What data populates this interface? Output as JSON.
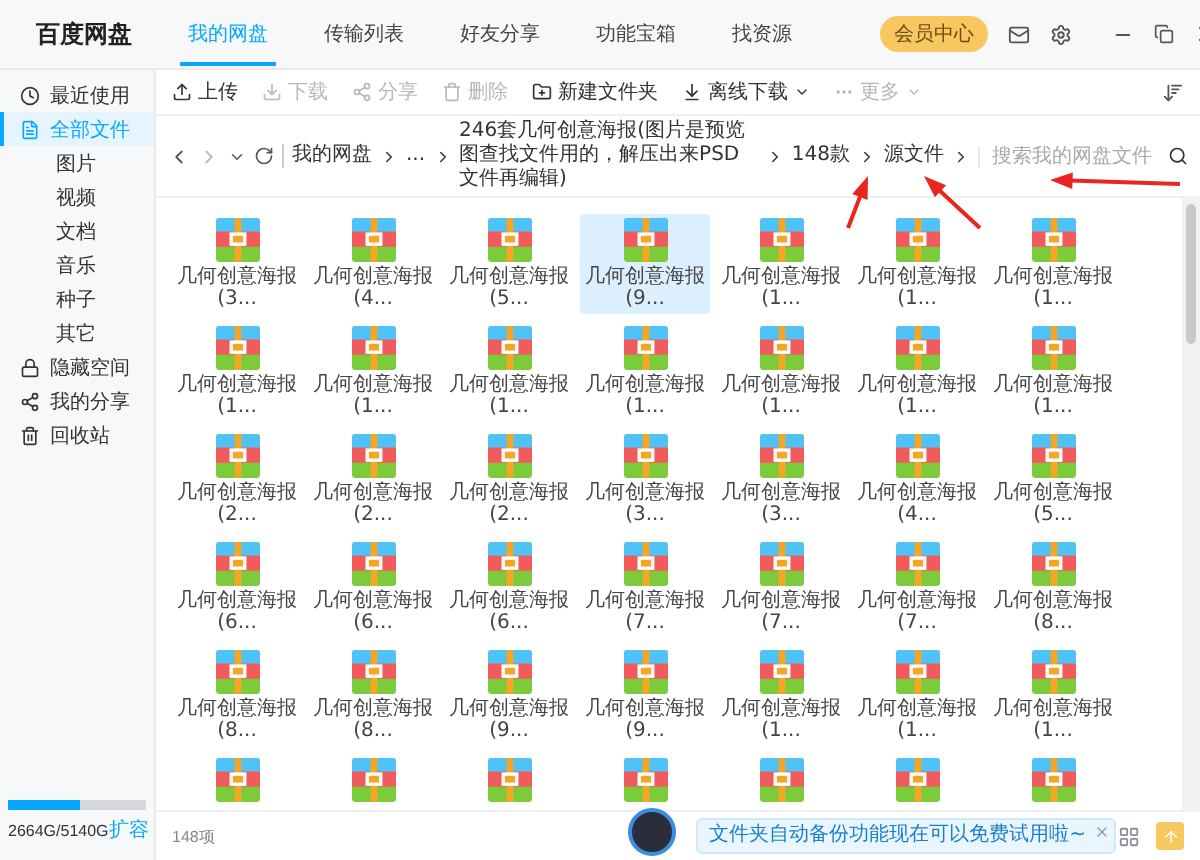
{
  "app": {
    "name": "百度网盘"
  },
  "nav_tabs": [
    {
      "label": "我的网盘",
      "selected": true
    },
    {
      "label": "传输列表",
      "selected": false
    },
    {
      "label": "好友分享",
      "selected": false
    },
    {
      "label": "功能宝箱",
      "selected": false
    },
    {
      "label": "找资源",
      "selected": false
    }
  ],
  "header": {
    "member_button": "会员中心"
  },
  "sidebar": {
    "items": [
      {
        "kind": "recent",
        "label": "最近使用",
        "selected": false
      },
      {
        "kind": "all",
        "label": "全部文件",
        "selected": true,
        "children": [
          {
            "label": "图片",
            "selected": false
          },
          {
            "label": "视频",
            "selected": false
          },
          {
            "label": "文档",
            "selected": false
          },
          {
            "label": "音乐",
            "selected": false
          },
          {
            "label": "种子",
            "selected": false
          },
          {
            "label": "其它",
            "selected": false
          }
        ]
      },
      {
        "kind": "hidden",
        "label": "隐藏空间",
        "selected": false
      },
      {
        "kind": "shares",
        "label": "我的分享",
        "selected": false
      },
      {
        "kind": "trash",
        "label": "回收站",
        "selected": false
      }
    ],
    "storage": {
      "text": "2664G/5140G",
      "level": 0.518,
      "expand_link": "扩容"
    }
  },
  "toolbar": {
    "actions": [
      {
        "kind": "upload",
        "label": "上传",
        "disabled": false
      },
      {
        "kind": "download",
        "label": "下载",
        "disabled": true
      },
      {
        "kind": "share",
        "label": "分享",
        "disabled": true
      },
      {
        "kind": "delete",
        "label": "删除",
        "disabled": true
      },
      {
        "kind": "new-folder",
        "label": "新建文件夹",
        "disabled": false
      },
      {
        "kind": "offline",
        "label": "离线下载",
        "disabled": false,
        "dropdown": true
      },
      {
        "kind": "more",
        "label": "更多",
        "disabled": true,
        "dropdown": true
      }
    ]
  },
  "breadcrumb": {
    "segments": [
      "我的网盘",
      "...",
      "246套几何创意海报(图片是预览图查找文件用的，解压出来PSD文件再编辑)",
      "148款",
      "源文件"
    ],
    "search_placeholder": "搜索我的网盘文件"
  },
  "files": [
    {
      "name": "几何创意海报 (3...",
      "selected": false
    },
    {
      "name": "几何创意海报 (4...",
      "selected": false
    },
    {
      "name": "几何创意海报 (5...",
      "selected": false
    },
    {
      "name": "几何创意海报 (9...",
      "selected": true
    },
    {
      "name": "几何创意海报 (1...",
      "selected": false
    },
    {
      "name": "几何创意海报 (1...",
      "selected": false
    },
    {
      "name": "几何创意海报 (1...",
      "selected": false
    },
    {
      "name": "几何创意海报 (1...",
      "selected": false
    },
    {
      "name": "几何创意海报 (1...",
      "selected": false
    },
    {
      "name": "几何创意海报 (1...",
      "selected": false
    },
    {
      "name": "几何创意海报 (1...",
      "selected": false
    },
    {
      "name": "几何创意海报 (1...",
      "selected": false
    },
    {
      "name": "几何创意海报 (1...",
      "selected": false
    },
    {
      "name": "几何创意海报 (1...",
      "selected": false
    },
    {
      "name": "几何创意海报 (2...",
      "selected": false
    },
    {
      "name": "几何创意海报 (2...",
      "selected": false
    },
    {
      "name": "几何创意海报 (2...",
      "selected": false
    },
    {
      "name": "几何创意海报 (3...",
      "selected": false
    },
    {
      "name": "几何创意海报 (3...",
      "selected": false
    },
    {
      "name": "几何创意海报 (4...",
      "selected": false
    },
    {
      "name": "几何创意海报 (5...",
      "selected": false
    },
    {
      "name": "几何创意海报 (6...",
      "selected": false
    },
    {
      "name": "几何创意海报 (6...",
      "selected": false
    },
    {
      "name": "几何创意海报 (6...",
      "selected": false
    },
    {
      "name": "几何创意海报 (7...",
      "selected": false
    },
    {
      "name": "几何创意海报 (7...",
      "selected": false
    },
    {
      "name": "几何创意海报 (7...",
      "selected": false
    },
    {
      "name": "几何创意海报 (8...",
      "selected": false
    },
    {
      "name": "几何创意海报 (8...",
      "selected": false
    },
    {
      "name": "几何创意海报 (8...",
      "selected": false
    },
    {
      "name": "几何创意海报 (9...",
      "selected": false
    },
    {
      "name": "几何创意海报 (9...",
      "selected": false
    },
    {
      "name": "几何创意海报 (1...",
      "selected": false
    },
    {
      "name": "几何创意海报 (1...",
      "selected": false
    },
    {
      "name": "几何创意海报 (1...",
      "selected": false
    },
    {
      "selected": false
    },
    {
      "selected": false
    },
    {
      "selected": false
    },
    {
      "selected": false
    },
    {
      "selected": false
    },
    {
      "selected": false
    },
    {
      "selected": false
    }
  ],
  "status_bar": {
    "count": "148项"
  },
  "notice": {
    "text": "文件夹自动备份功能现在可以免费试用啦~"
  }
}
